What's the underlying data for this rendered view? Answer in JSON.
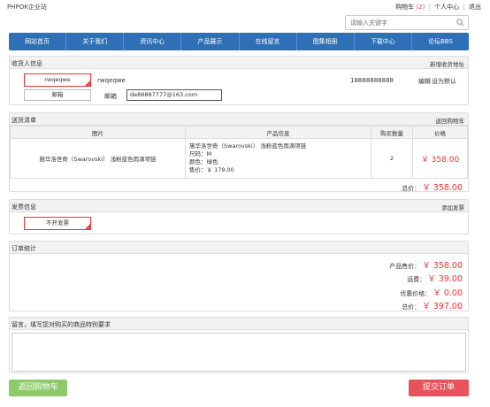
{
  "site": {
    "logo": "PHPOK企业站"
  },
  "toplinks": {
    "cart_label": "购物车",
    "cart_count": "(2)",
    "user_center": "个人中心",
    "logout": "退出"
  },
  "search": {
    "placeholder": "请输入关键字"
  },
  "nav": [
    "网站首页",
    "关于我们",
    "资讯中心",
    "产品展示",
    "在线留言",
    "图集相册",
    "下载中心",
    "论坛BBS"
  ],
  "receiver": {
    "title": "收货人信息",
    "add_link": "新增收货地址",
    "selected_name": "rwqeqwe",
    "name": "rwqeqwe",
    "phone": "18888888888",
    "edit": "编辑",
    "set_default": "设为默认",
    "email_button": "邮箱",
    "email_label": "邮箱",
    "email_value": "de88887777@163.com"
  },
  "order": {
    "title": "送货清单",
    "back_link": "返回购物车",
    "headers": [
      "图片",
      "产品信息",
      "购买数量",
      "价格"
    ],
    "item": {
      "image_text": "施华洛世奇（Swarovski） 浅粉蓝色雨滴项链",
      "name": "施华洛世奇（Swarovski） 浅粉蓝色雨滴项链",
      "size": "尺码：M",
      "color": "颜色：绿色",
      "unit_price": "售价：￥ 179.00",
      "qty": "2",
      "price": "￥ 358.00"
    },
    "total_label": "总价：",
    "total_value": "￥ 358.00"
  },
  "invoice": {
    "title": "发票信息",
    "add_link": "添加发票",
    "selected": "不开发票"
  },
  "stats": {
    "title": "订单统计",
    "rows": [
      {
        "label": "产品售价：",
        "value": "￥ 358.00"
      },
      {
        "label": "运费：",
        "value": "￥ 39.00"
      },
      {
        "label": "优惠价格：",
        "value": "￥ 0.00"
      },
      {
        "label": "总价：",
        "value": "￥ 397.00"
      }
    ]
  },
  "message": {
    "title": "留言，填写您对购买的商品特别要求",
    "value": ""
  },
  "buttons": {
    "back": "返回购物车",
    "submit": "提交订单"
  },
  "colors": {
    "nav": "#2f6fb5",
    "accent_red": "#e33333",
    "back_button": "#8ec96a",
    "submit_button": "#e8525b"
  }
}
